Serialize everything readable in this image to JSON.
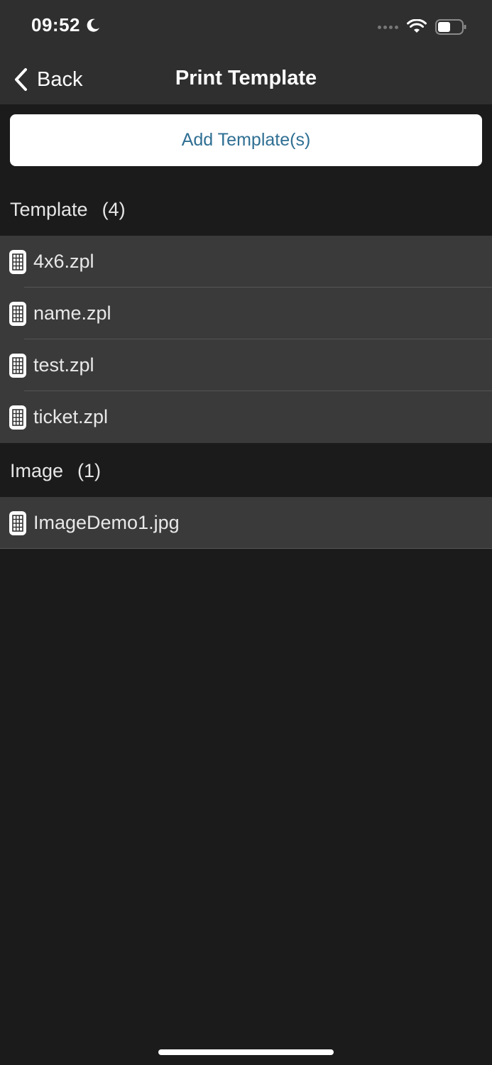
{
  "status_bar": {
    "time": "09:52",
    "icons": [
      "moon-icon",
      "cellular-signal-icon",
      "wifi-icon",
      "battery-icon"
    ]
  },
  "nav": {
    "back_label": "Back",
    "title": "Print Template"
  },
  "add_button": {
    "label": "Add Template(s)"
  },
  "sections": [
    {
      "title": "Template",
      "count": "(4)",
      "items": [
        {
          "label": "4x6.zpl",
          "icon": "file-icon"
        },
        {
          "label": "name.zpl",
          "icon": "file-icon"
        },
        {
          "label": "test.zpl",
          "icon": "file-icon"
        },
        {
          "label": "ticket.zpl",
          "icon": "file-icon"
        }
      ]
    },
    {
      "title": "Image",
      "count": "(1)",
      "items": [
        {
          "label": "ImageDemo1.jpg",
          "icon": "file-icon"
        }
      ]
    }
  ],
  "colors": {
    "background": "#1b1b1b",
    "bar": "#2f2f2f",
    "row": "#3a3a3a",
    "accent": "#2f6f93"
  }
}
